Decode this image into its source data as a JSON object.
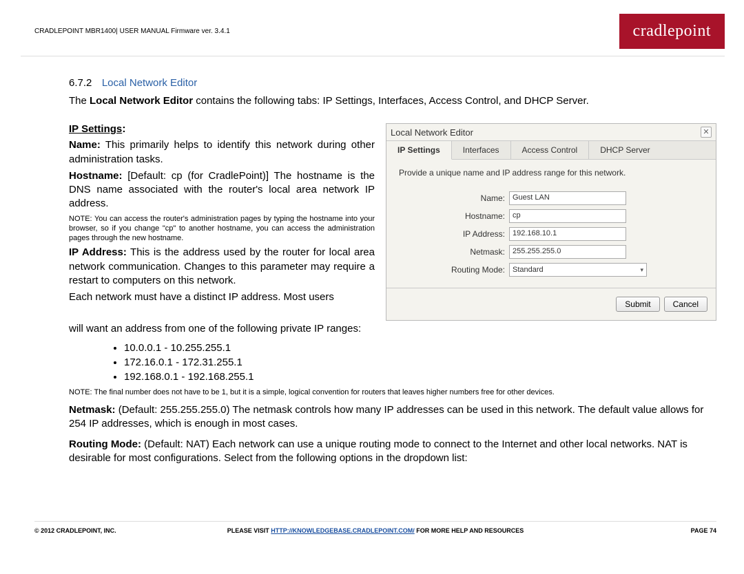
{
  "header": {
    "text": "CRADLEPOINT MBR1400| USER MANUAL Firmware ver. 3.4.1",
    "logo": "cradlepoint"
  },
  "section": {
    "number": "6.7.2",
    "title": "Local Network Editor",
    "intro_pre": "The ",
    "intro_bold": "Local Network Editor",
    "intro_post": " contains the following tabs: IP Settings, Interfaces, Access Control, and DHCP Server."
  },
  "ip_settings": {
    "heading": "IP Settings",
    "colon": ":",
    "name_label": "Name:",
    "name_text": " This primarily helps to identify this network during other administration tasks.",
    "hostname_label": "Hostname:",
    "hostname_text": " [Default: cp (for CradlePoint)] The hostname is the DNS name associated with the router's local area network IP address.",
    "note1": "NOTE: You can access the router's administration pages by typing the hostname into your browser, so if you change \"cp\" to another hostname, you can access the administration pages through the new hostname.",
    "ipaddr_label": "IP Address:",
    "ipaddr_text": " This is the address used by the router for local area network communication. Changes to this parameter may require a restart to computers on this network.",
    "distinct_line1": "Each network must have a distinct IP address. Most users",
    "distinct_line2": "will want an address from one of the following private IP ranges:",
    "ranges": [
      "10.0.0.1 - 10.255.255.1",
      "172.16.0.1 - 172.31.255.1",
      "192.168.0.1 - 192.168.255.1"
    ],
    "note2": "NOTE: The final number does not have to be 1, but it is a simple, logical convention for routers that leaves higher numbers free for other devices.",
    "netmask_label": "Netmask:",
    "netmask_text": " (Default: 255.255.255.0) The netmask controls how many IP addresses can be used in this network. The default value allows for 254 IP addresses, which is enough in most cases.",
    "routing_label": "Routing Mode:",
    "routing_text": " (Default: NAT) Each network can use a unique routing mode to connect to the Internet and other local networks. NAT is desirable for most configurations. Select from the following options in the dropdown list:"
  },
  "dialog": {
    "title": "Local Network Editor",
    "tabs": [
      "IP Settings",
      "Interfaces",
      "Access Control",
      "DHCP Server"
    ],
    "desc": "Provide a unique name and IP address range for this network.",
    "fields": {
      "name_label": "Name:",
      "name_value": "Guest LAN",
      "hostname_label": "Hostname:",
      "hostname_value": "cp",
      "ip_label": "IP Address:",
      "ip_value": "192.168.10.1",
      "netmask_label": "Netmask:",
      "netmask_value": "255.255.255.0",
      "routing_label": "Routing Mode:",
      "routing_value": "Standard"
    },
    "submit": "Submit",
    "cancel": "Cancel"
  },
  "footer": {
    "left": "© 2012 CRADLEPOINT, INC.",
    "center_pre": "PLEASE VISIT ",
    "center_link": "HTTP://KNOWLEDGEBASE.CRADLEPOINT.COM/",
    "center_post": " FOR MORE HELP AND RESOURCES",
    "right": "PAGE 74"
  }
}
